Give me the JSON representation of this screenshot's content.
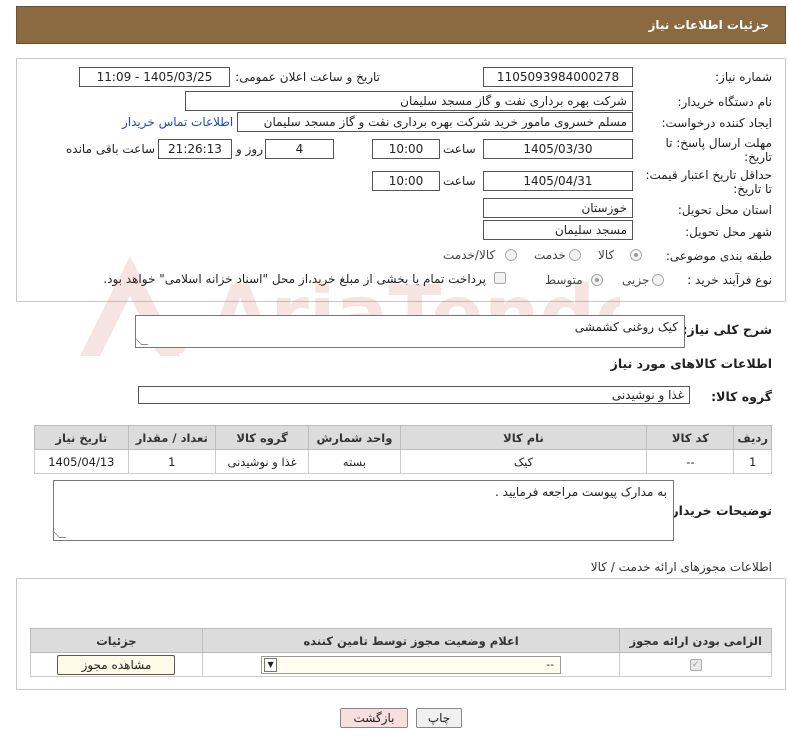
{
  "header": {
    "title": "جزئیات اطلاعات نیاز"
  },
  "form": {
    "need_number": {
      "label": "شماره نیاز:",
      "value": "1105093984000278"
    },
    "announce_datetime": {
      "label": "تاریخ و ساعت اعلان عمومی:",
      "value": "1405/03/25 - 11:09"
    },
    "buyer_org": {
      "label": "نام دستگاه خریدار:",
      "value": "شرکت بهره برداری نفت و گاز مسجد سلیمان"
    },
    "requester": {
      "label": "ایجاد کننده درخواست:",
      "value": "مسلم خسروی مامور خرید شرکت بهره برداری نفت و گاز مسجد سلیمان",
      "contact_link": "اطلاعات تماس خریدار"
    },
    "reply_deadline": {
      "label_line1": "مهلت ارسال پاسخ: تا",
      "label_line2": "تاریخ:",
      "date": "1405/03/30",
      "time_label": "ساعت",
      "time": "10:00",
      "days": "4",
      "days_label": "روز و",
      "remaining": "21:26:13",
      "remaining_label": "ساعت باقی مانده"
    },
    "price_validity": {
      "label_line1": "حداقل تاریخ اعتبار قیمت:",
      "label_line2": "تا تاریخ:",
      "date": "1405/04/31",
      "time_label": "ساعت",
      "time": "10:00"
    },
    "province": {
      "label": "استان محل تحویل:",
      "value": "خوزستان"
    },
    "city": {
      "label": "شهر محل تحویل:",
      "value": "مسجد سلیمان"
    },
    "category": {
      "label": "طبقه بندی موضوعی:",
      "options": [
        "کالا",
        "خدمت",
        "کالا/خدمت"
      ],
      "selected": "کالا"
    },
    "process_type": {
      "label": "نوع فرآیند خرید :",
      "options": [
        "جزیی",
        "متوسط"
      ],
      "selected": "متوسط",
      "payment_note": "پرداخت تمام یا بخشی از مبلغ خرید،از محل \"اسناد خزانه اسلامی\" خواهد بود."
    }
  },
  "description": {
    "label": "شرح کلی نیاز:",
    "value": "کیک روغنی کشمشی"
  },
  "goods_section": {
    "title": "اطلاعات کالاهای مورد نیاز",
    "group_label": "گروه کالا:",
    "group_value": "غذا و نوشیدنی"
  },
  "goods_table": {
    "headers": [
      "ردیف",
      "کد کالا",
      "نام کالا",
      "واحد شمارش",
      "گروه کالا",
      "تعداد / مقدار",
      "تاریخ نیاز"
    ],
    "rows": [
      [
        "1",
        "--",
        "کیک",
        "بسته",
        "غذا و نوشیدنی",
        "1",
        "1405/04/13"
      ]
    ]
  },
  "buyer_notes": {
    "label": "توضیحات خریدار:",
    "value": "به مدارک پیوست مراجعه فرمایید ."
  },
  "permits": {
    "title": "اطلاعات مجوزهای ارائه خدمت / کالا",
    "headers": [
      "الزامی بودن ارائه مجوز",
      "اعلام وضعیت مجوز توسط تامین کننده",
      "جزئیات"
    ],
    "select_value": "--",
    "view_button": "مشاهده مجوز"
  },
  "buttons": {
    "print": "چاپ",
    "back": "بازگشت"
  },
  "watermark": "AriaTender.net",
  "colors": {
    "header_bg": "#8b6a42",
    "link": "#1a4fb5",
    "back_button_bg": "#f9dede"
  }
}
